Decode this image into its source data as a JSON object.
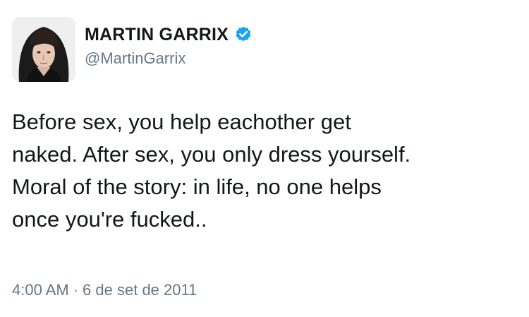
{
  "tweet": {
    "author": {
      "display_name": "MARTIN GARRIX",
      "handle": "@MartinGarrix",
      "verified": true,
      "verified_icon": "verified-badge-icon",
      "accent_color": "#1da1f2"
    },
    "text_lines": [
      "Before sex, you help eachother get",
      "naked. After sex, you only dress yourself.",
      "Moral of the story: in life, no one helps",
      "once you're fucked.."
    ],
    "time": "4:00 AM",
    "separator": "·",
    "date": "6 de set de 2011",
    "colors": {
      "text": "#14171a",
      "secondary": "#657786",
      "background": "#ffffff"
    }
  }
}
